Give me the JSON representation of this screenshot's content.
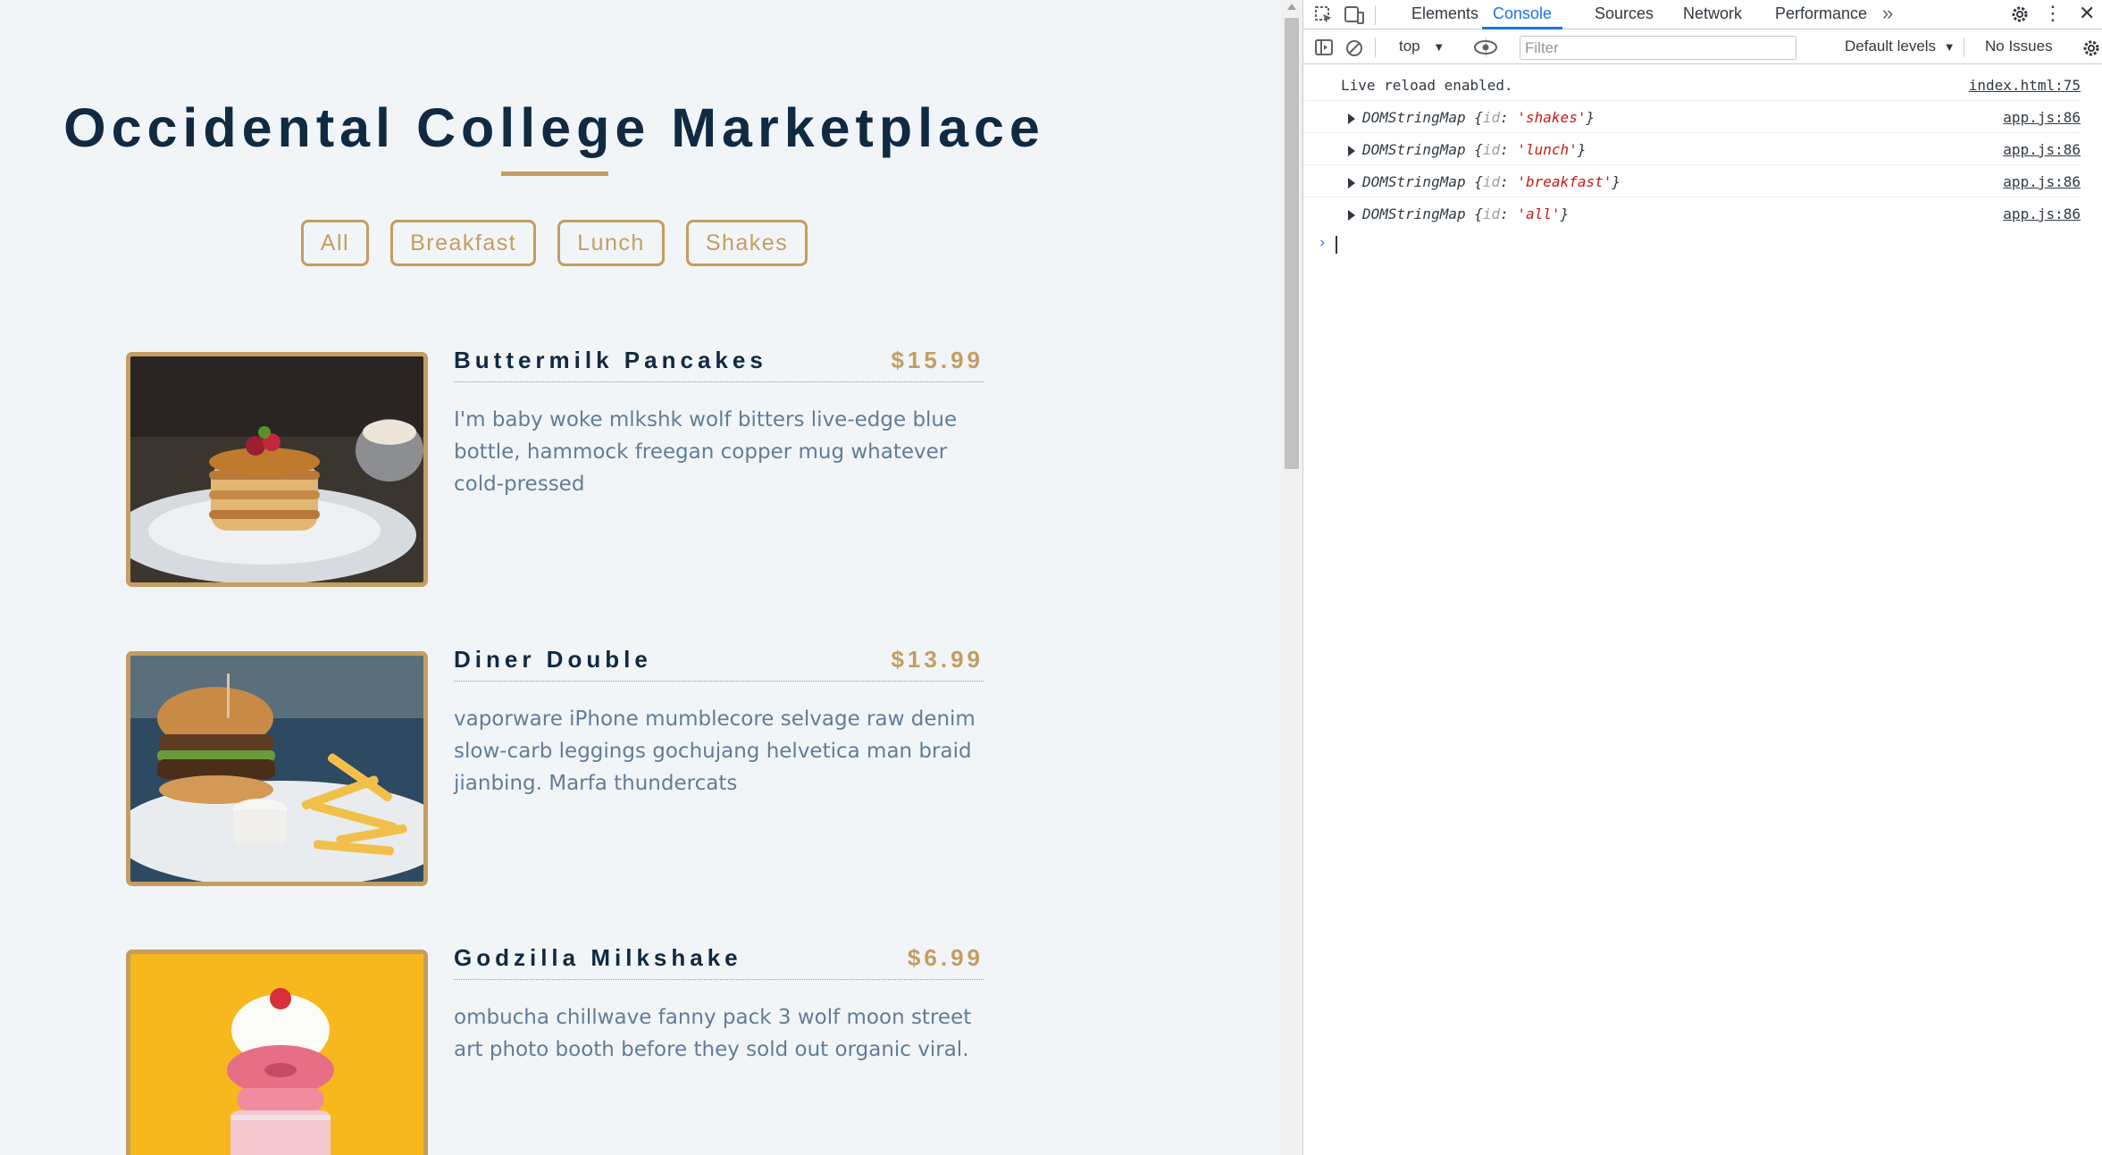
{
  "page": {
    "title": "Occidental College Marketplace",
    "filters": [
      "All",
      "Breakfast",
      "Lunch",
      "Shakes"
    ],
    "accent_color": "#c59d5f",
    "heading_color": "#102a42",
    "items": [
      {
        "title": "Buttermilk Pancakes",
        "price": "$15.99",
        "desc": "I'm baby woke mlkshk wolf bitters live-edge blue bottle, hammock freegan copper mug whatever cold-pressed",
        "image_icon": "pancakes-photo"
      },
      {
        "title": "Diner Double",
        "price": "$13.99",
        "desc": "vaporware iPhone mumblecore selvage raw denim slow-carb leggings gochujang helvetica man braid jianbing. Marfa thundercats",
        "image_icon": "burger-photo"
      },
      {
        "title": "Godzilla Milkshake",
        "price": "$6.99",
        "desc": "ombucha chillwave fanny pack 3 wolf moon street art photo booth before they sold out organic viral.",
        "image_icon": "milkshake-photo"
      }
    ]
  },
  "devtools": {
    "tabs": [
      "Elements",
      "Console",
      "Sources",
      "Network",
      "Performance"
    ],
    "active_tab": "Console",
    "context": "top",
    "filter_placeholder": "Filter",
    "levels": "Default levels",
    "issues": "No Issues",
    "messages": [
      {
        "text": "Live reload enabled.",
        "source": "index.html:75"
      },
      {
        "type": "DOMStringMap",
        "key": "id",
        "value": "'shakes'",
        "source": "app.js:86"
      },
      {
        "type": "DOMStringMap",
        "key": "id",
        "value": "'lunch'",
        "source": "app.js:86"
      },
      {
        "type": "DOMStringMap",
        "key": "id",
        "value": "'breakfast'",
        "source": "app.js:86"
      },
      {
        "type": "DOMStringMap",
        "key": "id",
        "value": "'all'",
        "source": "app.js:86"
      }
    ],
    "prompt": "›"
  }
}
